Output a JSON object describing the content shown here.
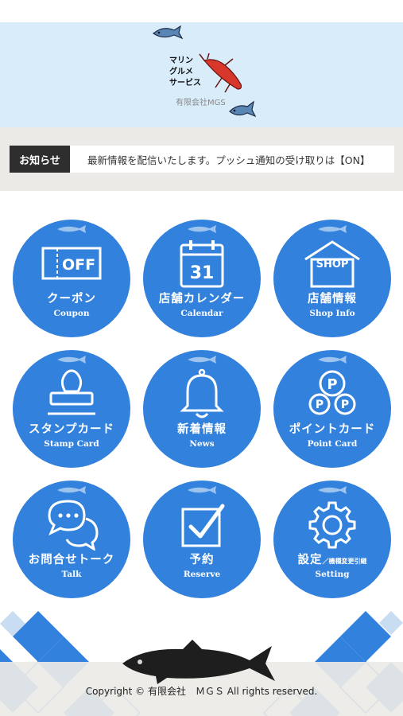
{
  "header": {
    "logo_text": "マリン\nグルメ\nサービス",
    "company": "有限会社MGS"
  },
  "notice": {
    "label": "お知らせ",
    "message": "最新情報を配信いたします。プッシュ通知の受け取りは【ON】"
  },
  "menu": [
    {
      "jp": "クーポン",
      "en": "Coupon",
      "icon": "coupon-off-icon",
      "icon_text": "OFF"
    },
    {
      "jp": "店舗カレンダー",
      "en": "Calendar",
      "icon": "calendar-icon",
      "icon_text": "31"
    },
    {
      "jp": "店舗情報",
      "en": "Shop Info",
      "icon": "shop-icon",
      "icon_text": "SHOP"
    },
    {
      "jp": "スタンプカード",
      "en": "Stamp Card",
      "icon": "stamp-icon"
    },
    {
      "jp": "新着情報",
      "en": "News",
      "icon": "bell-icon"
    },
    {
      "jp": "ポイントカード",
      "en": "Point Card",
      "icon": "point-coins-icon",
      "icon_text": "P"
    },
    {
      "jp": "お問合せトーク",
      "en": "Talk",
      "icon": "chat-bubbles-icon"
    },
    {
      "jp": "予約",
      "en": "Reserve",
      "icon": "checkbox-icon"
    },
    {
      "jp": "設定",
      "jp_sub": "／機種変更引継",
      "en": "Setting",
      "icon": "gear-icon"
    }
  ],
  "footer": {
    "copyright": "Copyright © 有限会社　ＭＧＳ All rights reserved."
  },
  "colors": {
    "accent": "#3181dd",
    "header_bg": "#d8ecfa",
    "notice_bg": "#eceae6",
    "notice_label_bg": "#2e2e2e"
  }
}
